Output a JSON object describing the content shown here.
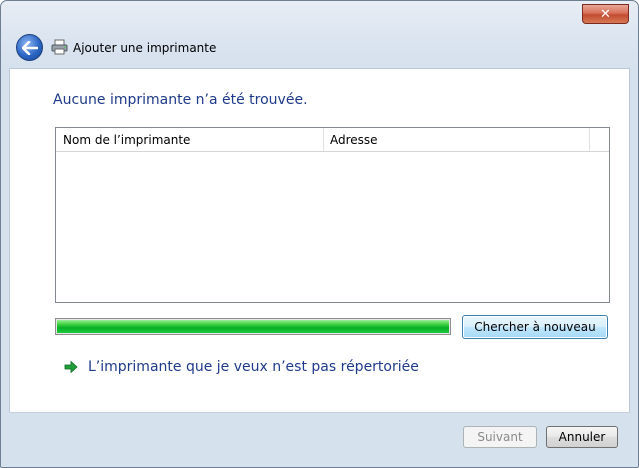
{
  "window": {
    "title": "Ajouter une imprimante",
    "close_label": "✕"
  },
  "main": {
    "heading": "Aucune imprimante n’a été trouvée.",
    "list": {
      "columns": [
        "Nom de l’imprimante",
        "Adresse"
      ],
      "rows": []
    },
    "progress": {
      "value": 1.0,
      "color": "#06b025"
    },
    "search_again_label": "Chercher à nouveau",
    "not_listed_link": "L’imprimante que je veux n’est pas répertoriée"
  },
  "footer": {
    "next_label": "Suivant",
    "next_enabled": false,
    "cancel_label": "Annuler"
  },
  "colors": {
    "heading": "#1e3a8a",
    "link": "#1e3a8a",
    "progress": "#06b025"
  },
  "icons": [
    "close-icon",
    "back-arrow-icon",
    "printer-icon",
    "green-arrow-icon"
  ]
}
